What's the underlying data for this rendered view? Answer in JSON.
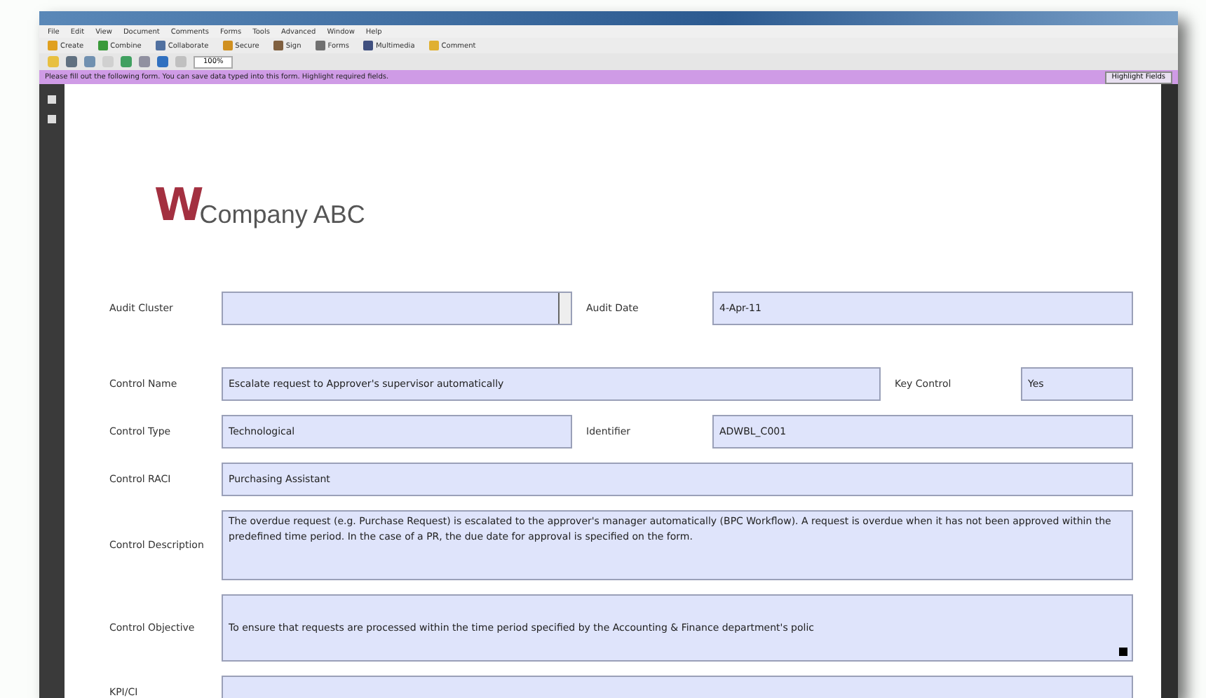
{
  "menu": [
    "File",
    "Edit",
    "View",
    "Document",
    "Comments",
    "Forms",
    "Tools",
    "Advanced",
    "Window",
    "Help"
  ],
  "toolbar": [
    {
      "label": "Create",
      "color": "#e0a020"
    },
    {
      "label": "Combine",
      "color": "#3a9a3a"
    },
    {
      "label": "Collaborate",
      "color": "#5070a0"
    },
    {
      "label": "Secure",
      "color": "#d09020"
    },
    {
      "label": "Sign",
      "color": "#806040"
    },
    {
      "label": "Forms",
      "color": "#707070"
    },
    {
      "label": "Multimedia",
      "color": "#405080"
    },
    {
      "label": "Comment",
      "color": "#e0b030"
    }
  ],
  "zoom": "100%",
  "notice": {
    "text": "Please fill out the following form. You can save data typed into this form. Highlight required fields.",
    "button": "Highlight Fields"
  },
  "logo": {
    "mark": "W",
    "name": "Company ABC"
  },
  "rows": [
    {
      "kind": "pair",
      "fields": [
        {
          "label": "Audit Cluster",
          "dropdown": true
        },
        {
          "label": "Audit Date",
          "value": "4-Apr-11",
          "dropdown": false
        }
      ]
    },
    {
      "kind": "widepair",
      "fields": [
        {
          "label": "Control Name",
          "value": "Escalate request to Approver's supervisor automatically",
          "dropdown": false
        },
        {
          "label": "Key Control",
          "value": "Yes",
          "dropdown": false
        }
      ]
    },
    {
      "kind": "pair",
      "fields": [
        {
          "label": "Control Type",
          "value": "Technological",
          "dropdown": false
        },
        {
          "label": "Identifier",
          "value": "ADWBL_C001",
          "dropdown": false
        }
      ]
    },
    {
      "kind": "single",
      "fields": [
        {
          "label": "Control RACI",
          "value": "Purchasing Assistant"
        }
      ]
    },
    {
      "kind": "text",
      "fields": [
        {
          "label": "Control Description",
          "value": "The overdue request (e.g. Purchase Request) is escalated to the approver's manager automatically (BPC Workflow). A request is overdue when it has not been approved within the predefined time period. In the case of a PR, the due date for approval is specified on the form."
        }
      ]
    },
    {
      "kind": "text",
      "overflow": true,
      "fields": [
        {
          "label": "Control Objective",
          "value": "To ensure that requests are processed within the time period specified by the Accounting & Finance department's polic"
        }
      ]
    },
    {
      "kind": "cut",
      "fields": [
        {
          "label": "KPI/CI"
        }
      ]
    }
  ]
}
